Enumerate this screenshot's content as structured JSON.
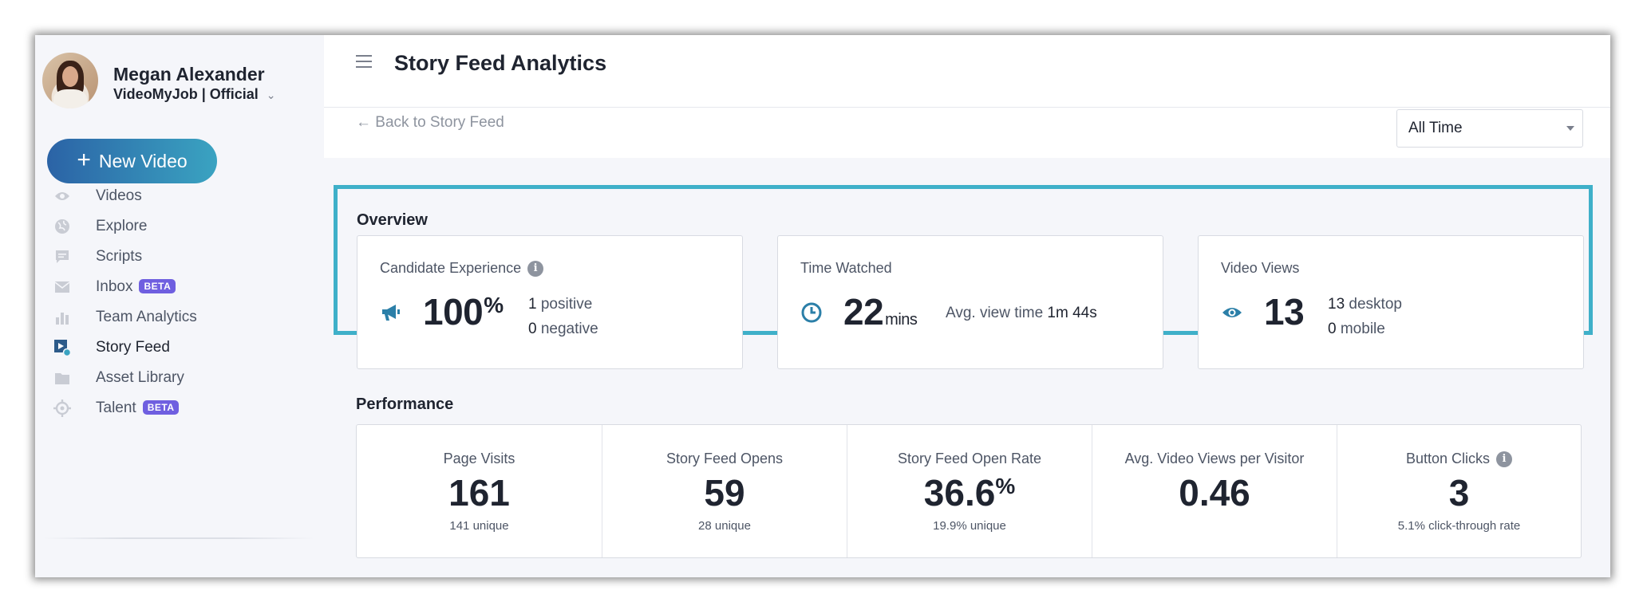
{
  "user": {
    "name": "Megan Alexander",
    "org": "VideoMyJob | Official"
  },
  "new_video_label": "New Video",
  "nav": [
    {
      "label": "Videos",
      "icon": "eye-icon"
    },
    {
      "label": "Explore",
      "icon": "globe-icon"
    },
    {
      "label": "Scripts",
      "icon": "chat-icon"
    },
    {
      "label": "Inbox",
      "icon": "mail-icon",
      "badge": "BETA"
    },
    {
      "label": "Team Analytics",
      "icon": "bar-chart-icon"
    },
    {
      "label": "Story Feed",
      "icon": "story-feed-icon",
      "active": true
    },
    {
      "label": "Asset Library",
      "icon": "folder-icon"
    },
    {
      "label": "Talent",
      "icon": "crosshair-icon",
      "badge": "BETA"
    }
  ],
  "header": {
    "title": "Story Feed Analytics"
  },
  "back_link": "← Back to Story Feed",
  "time_filter": {
    "selected": "All Time"
  },
  "overview": {
    "title": "Overview",
    "candidate_experience": {
      "label": "Candidate Experience",
      "value": "100",
      "suffix": "%",
      "positive_count": "1",
      "positive_label": "positive",
      "negative_count": "0",
      "negative_label": "negative"
    },
    "time_watched": {
      "label": "Time Watched",
      "value": "22",
      "suffix": "mins",
      "avg_label": "Avg. view time",
      "avg_value": "1m 44s"
    },
    "video_views": {
      "label": "Video Views",
      "value": "13",
      "desktop_count": "13",
      "desktop_label": "desktop",
      "mobile_count": "0",
      "mobile_label": "mobile"
    }
  },
  "performance": {
    "title": "Performance",
    "metrics": [
      {
        "label": "Page Visits",
        "value": "161",
        "suffix": "",
        "sub": "141 unique"
      },
      {
        "label": "Story Feed Opens",
        "value": "59",
        "suffix": "",
        "sub": "28 unique"
      },
      {
        "label": "Story Feed Open Rate",
        "value": "36.6",
        "suffix": "%",
        "sub": "19.9% unique"
      },
      {
        "label": "Avg. Video Views per Visitor",
        "value": "0.46",
        "suffix": "",
        "sub": ""
      },
      {
        "label": "Button Clicks",
        "value": "3",
        "suffix": "",
        "sub": "5.1% click-through rate",
        "info": true
      }
    ]
  },
  "colors": {
    "accent": "#3fb0c9",
    "button_gradient_start": "#2b63a6",
    "button_gradient_end": "#3aa3c1",
    "icon_teal": "#2b7fa8",
    "beta_badge": "#6f5fe0"
  }
}
